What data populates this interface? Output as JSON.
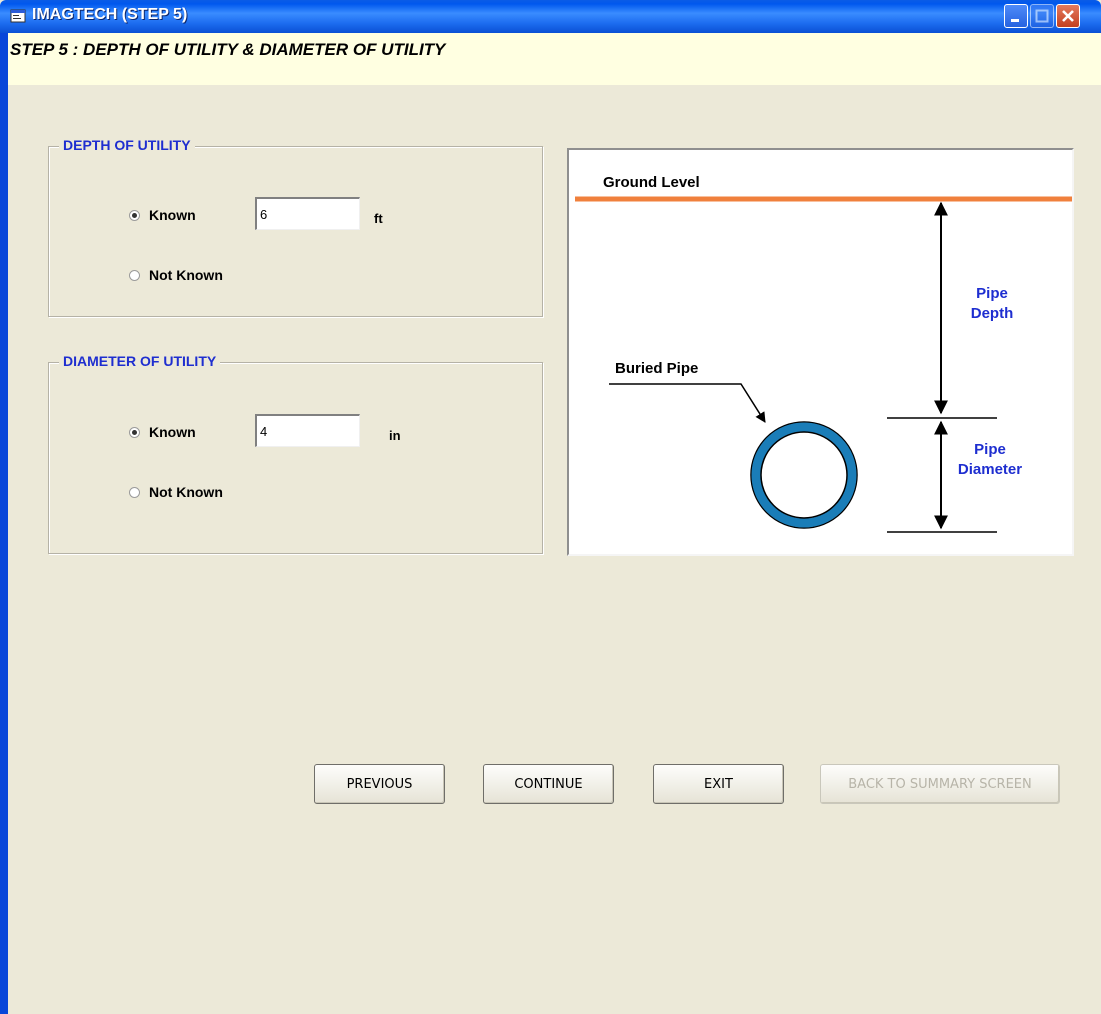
{
  "window": {
    "title": "IMAGTECH (STEP 5)"
  },
  "step_header": "STEP 5 : DEPTH OF UTILITY & DIAMETER OF UTILITY",
  "depth_group": {
    "legend": "DEPTH OF UTILITY",
    "known_label": "Known",
    "not_known_label": "Not Known",
    "selected": "Known",
    "value": "6",
    "unit": "ft"
  },
  "diameter_group": {
    "legend": "DIAMETER OF UTILITY",
    "known_label": "Known",
    "not_known_label": "Not Known",
    "selected": "Known",
    "value": "4",
    "unit": "in"
  },
  "diagram": {
    "ground_level": "Ground Level",
    "buried_pipe": "Buried Pipe",
    "pipe_depth_line1": "Pipe",
    "pipe_depth_line2": "Depth",
    "pipe_diameter_line1": "Pipe",
    "pipe_diameter_line2": "Diameter",
    "ground_color": "#F0803C",
    "pipe_color": "#1A7DB8",
    "label_color": "#1E2ED0"
  },
  "buttons": {
    "previous": "PREVIOUS",
    "continue": "CONTINUE",
    "exit": "EXIT",
    "back_to_summary": "BACK TO SUMMARY SCREEN"
  },
  "icons": {
    "window": "app-window-icon",
    "minimize": "minimize-icon",
    "maximize": "maximize-icon",
    "close": "close-icon"
  }
}
